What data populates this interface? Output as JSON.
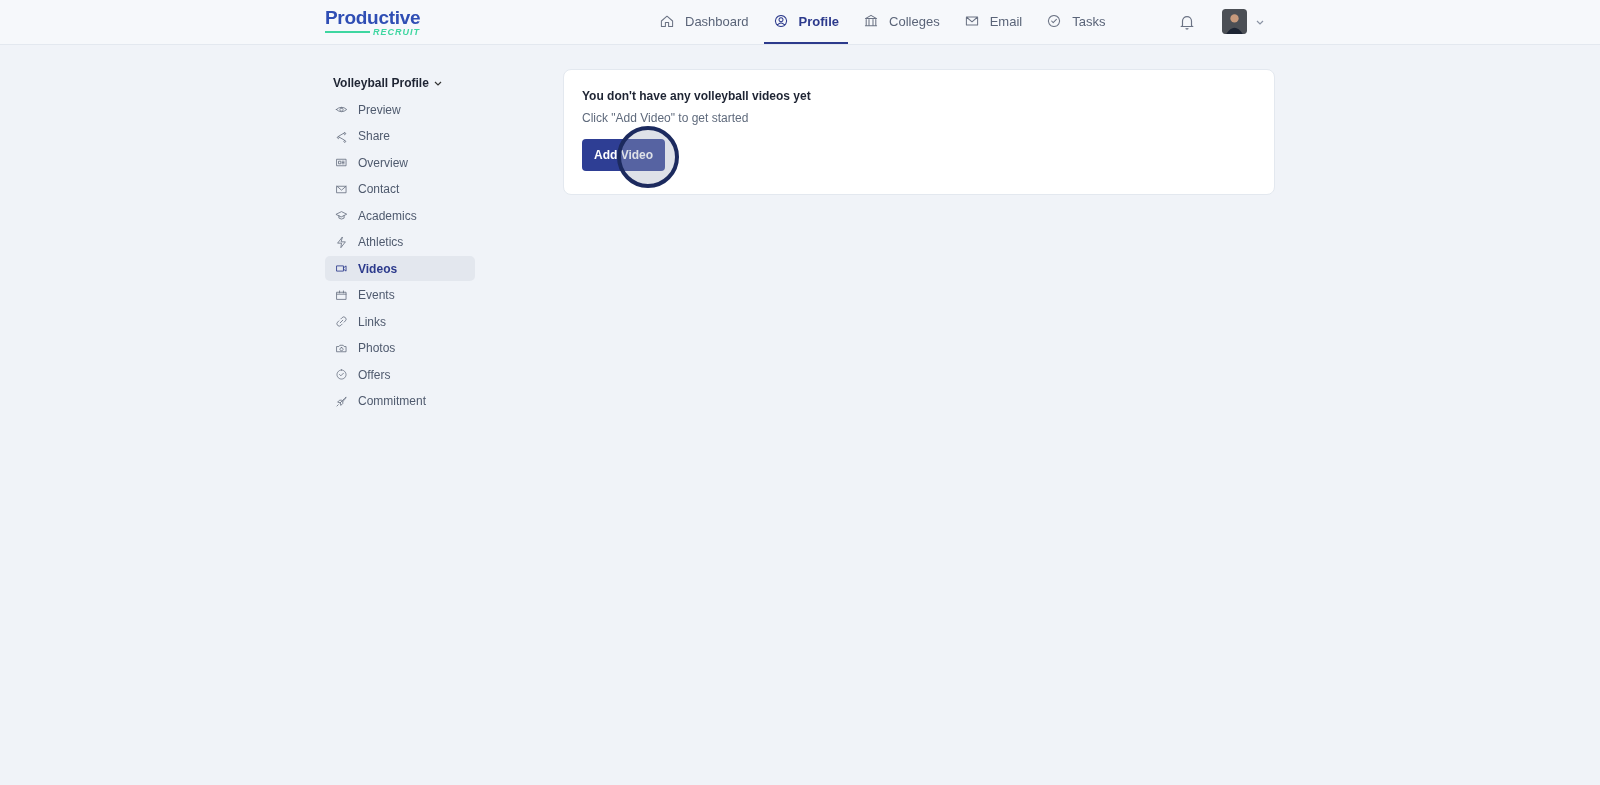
{
  "logo": {
    "name": "Productive",
    "sub": "RECRUIT"
  },
  "nav": [
    {
      "label": "Dashboard",
      "selected": false
    },
    {
      "label": "Profile",
      "selected": true
    },
    {
      "label": "Colleges",
      "selected": false
    },
    {
      "label": "Email",
      "selected": false
    },
    {
      "label": "Tasks",
      "selected": false
    }
  ],
  "sidebar": {
    "title": "Volleyball Profile",
    "items": [
      {
        "label": "Preview",
        "selected": false
      },
      {
        "label": "Share",
        "selected": false
      },
      {
        "label": "Overview",
        "selected": false
      },
      {
        "label": "Contact",
        "selected": false
      },
      {
        "label": "Academics",
        "selected": false
      },
      {
        "label": "Athletics",
        "selected": false
      },
      {
        "label": "Videos",
        "selected": true
      },
      {
        "label": "Events",
        "selected": false
      },
      {
        "label": "Links",
        "selected": false
      },
      {
        "label": "Photos",
        "selected": false
      },
      {
        "label": "Offers",
        "selected": false
      },
      {
        "label": "Commitment",
        "selected": false
      }
    ]
  },
  "empty_state": {
    "title": "You don't have any volleyball videos yet",
    "hint": "Click \"Add Video\" to get started",
    "button": "Add Video"
  }
}
